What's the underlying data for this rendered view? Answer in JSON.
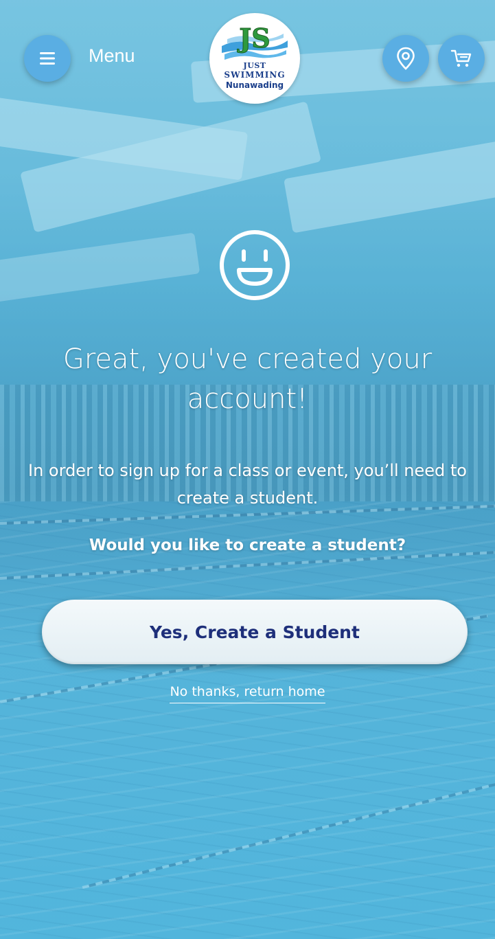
{
  "header": {
    "menu_label": "Menu",
    "menu_icon": "hamburger-menu-icon",
    "map_icon": "location-pin-icon",
    "cart_icon": "shopping-cart-icon",
    "logo": {
      "line1": "JUST",
      "line2": "SWIMMING",
      "line3": "Nunawading",
      "monogram": "JS"
    },
    "button_color": "#5aaee3"
  },
  "main": {
    "emoji_icon": "smiley-face-icon",
    "headline": "Great, you've created your account!",
    "info": "In order to sign up for a class or event, you’ll need to create a student.",
    "question": "Would you like to create a student?",
    "primary_button": "Yes, Create a Student",
    "secondary_link": "No thanks, return home"
  },
  "colors": {
    "button_text": "#1e2f7a",
    "overlay_tint": "#5ab4d6",
    "text": "#ffffff"
  }
}
